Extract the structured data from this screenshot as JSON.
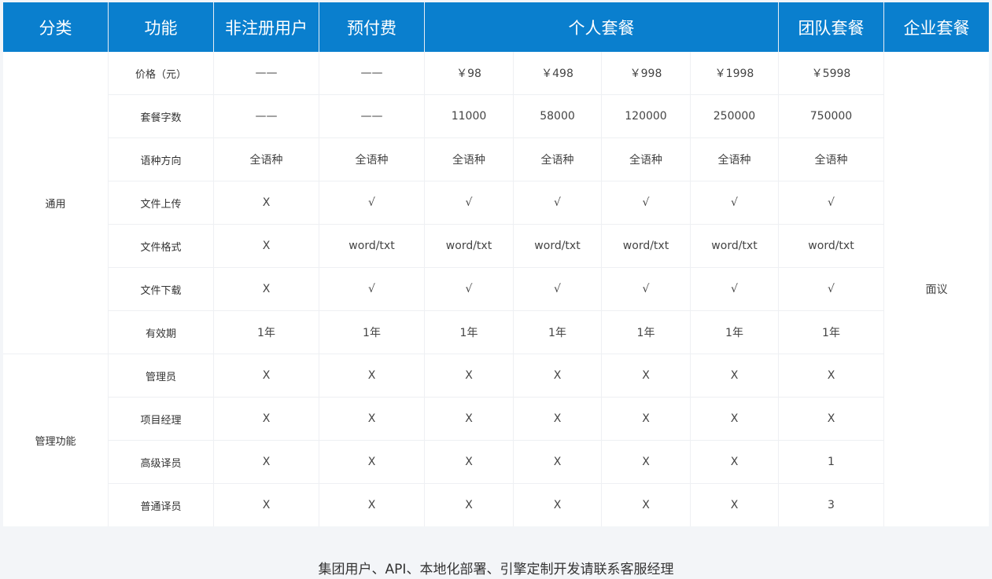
{
  "header": {
    "category": "分类",
    "feature": "功能",
    "unregistered": "非注册用户",
    "prepaid": "预付费",
    "personal": "个人套餐",
    "team": "团队套餐",
    "enterprise": "企业套餐"
  },
  "categories": {
    "general": "通用",
    "management": "管理功能"
  },
  "enterprise_value": "面议",
  "rows": [
    {
      "feature": "价格（元）",
      "values": [
        "——",
        "——",
        "￥98",
        "￥498",
        "￥998",
        "￥1998",
        "￥5998"
      ]
    },
    {
      "feature": "套餐字数",
      "values": [
        "——",
        "——",
        "11000",
        "58000",
        "120000",
        "250000",
        "750000"
      ]
    },
    {
      "feature": "语种方向",
      "values": [
        "全语种",
        "全语种",
        "全语种",
        "全语种",
        "全语种",
        "全语种",
        "全语种"
      ]
    },
    {
      "feature": "文件上传",
      "values": [
        "X",
        "√",
        "√",
        "√",
        "√",
        "√",
        "√"
      ]
    },
    {
      "feature": "文件格式",
      "values": [
        "X",
        "word/txt",
        "word/txt",
        "word/txt",
        "word/txt",
        "word/txt",
        "word/txt"
      ]
    },
    {
      "feature": "文件下载",
      "values": [
        "X",
        "√",
        "√",
        "√",
        "√",
        "√",
        "√"
      ]
    },
    {
      "feature": "有效期",
      "values": [
        "1年",
        "1年",
        "1年",
        "1年",
        "1年",
        "1年",
        "1年"
      ]
    },
    {
      "feature": "管理员",
      "values": [
        "X",
        "X",
        "X",
        "X",
        "X",
        "X",
        "X"
      ]
    },
    {
      "feature": "项目经理",
      "values": [
        "X",
        "X",
        "X",
        "X",
        "X",
        "X",
        "X"
      ]
    },
    {
      "feature": "高级译员",
      "values": [
        "X",
        "X",
        "X",
        "X",
        "X",
        "X",
        "1"
      ]
    },
    {
      "feature": "普通译员",
      "values": [
        "X",
        "X",
        "X",
        "X",
        "X",
        "X",
        "3"
      ]
    }
  ],
  "footer_note": "集团用户、API、本地化部署、引擎定制开发请联系客服经理"
}
